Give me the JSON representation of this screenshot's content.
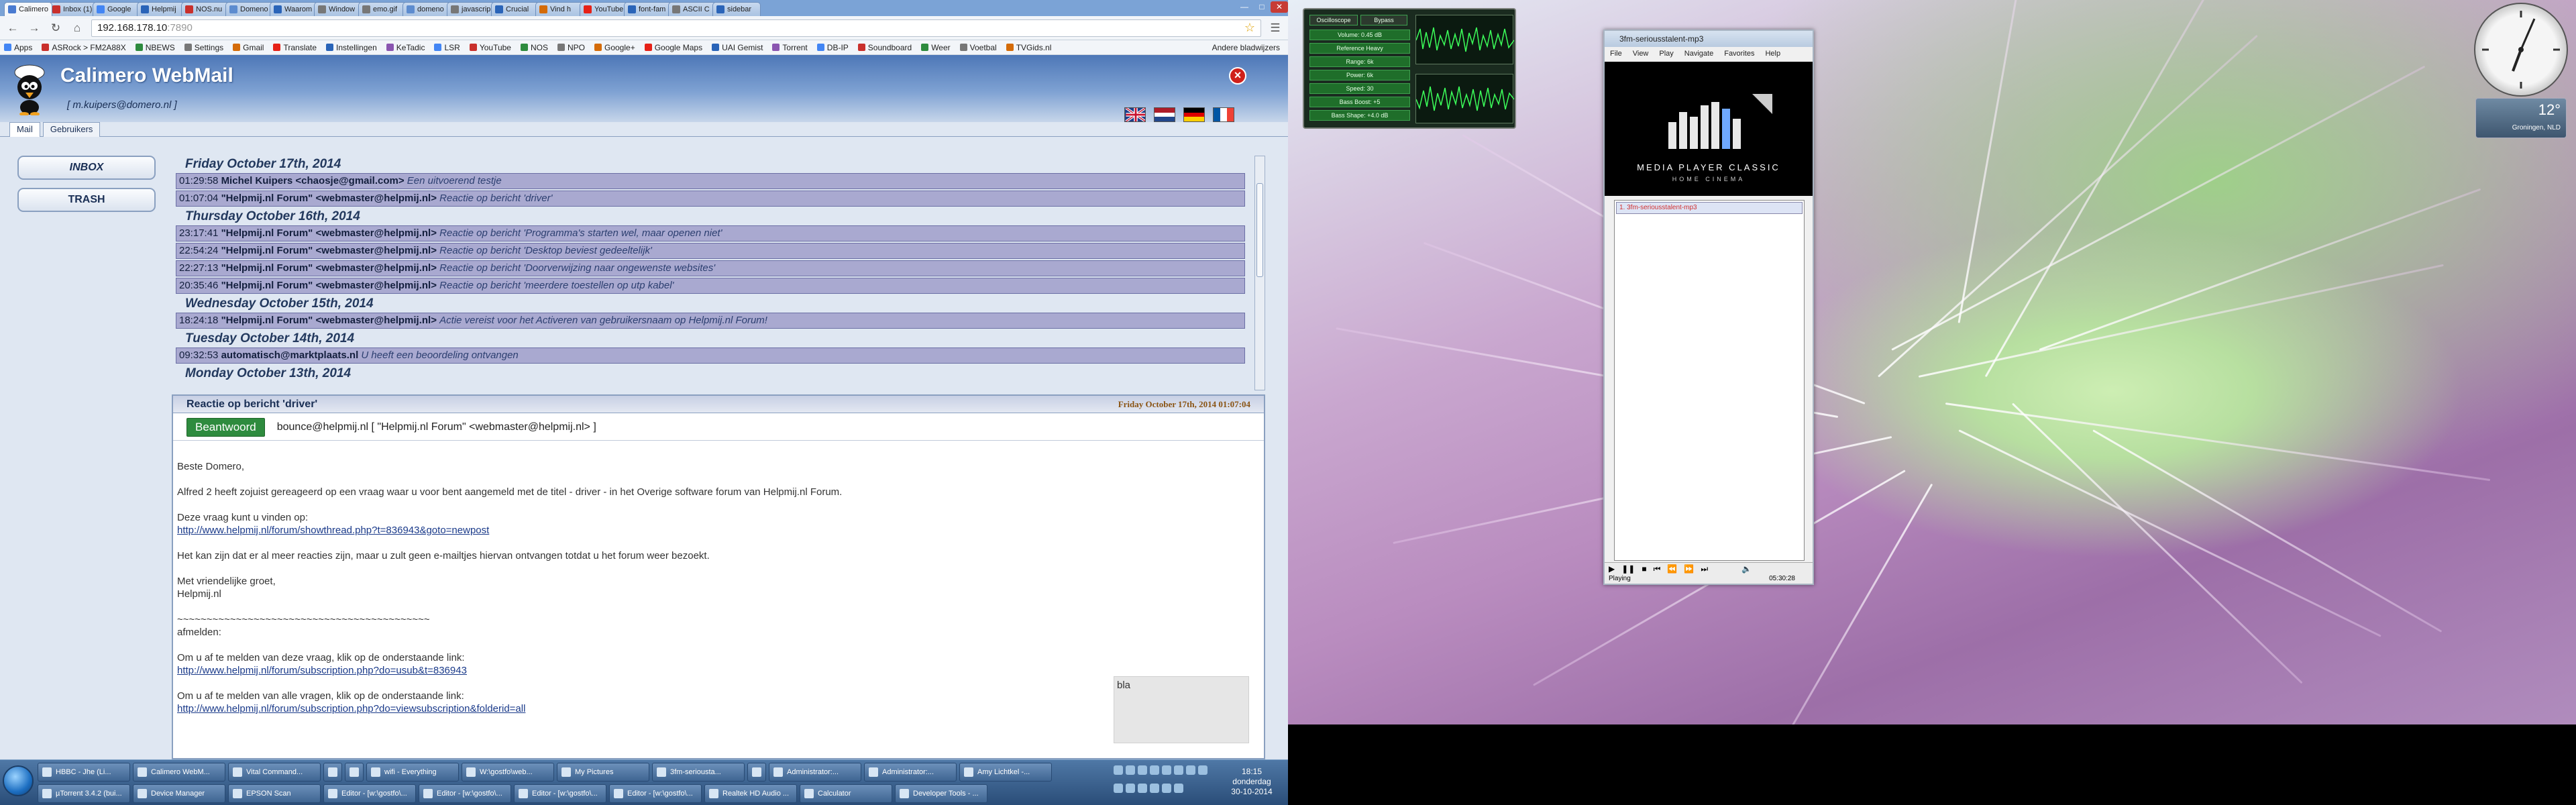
{
  "browser": {
    "tabs": [
      {
        "label": "Calimero",
        "color": "#4a7bd1",
        "active": true
      },
      {
        "label": "Inbox (1)",
        "color": "#c9302c"
      },
      {
        "label": "Google",
        "color": "#4285f4"
      },
      {
        "label": "Helpmij",
        "color": "#2a64b8"
      },
      {
        "label": "NOS.nu",
        "color": "#c9302c"
      },
      {
        "label": "Domeno",
        "color": "#5d8ccf"
      },
      {
        "label": "Waarom",
        "color": "#2a64b8"
      },
      {
        "label": "Window",
        "color": "#777777"
      },
      {
        "label": "emo.gif",
        "color": "#777777"
      },
      {
        "label": "domeno",
        "color": "#5d8ccf"
      },
      {
        "label": "javascrip",
        "color": "#777777"
      },
      {
        "label": "Crucial",
        "color": "#2a64b8"
      },
      {
        "label": "Vind h",
        "color": "#d46b08"
      },
      {
        "label": "YouTube",
        "color": "#e62117"
      },
      {
        "label": "font-fam",
        "color": "#2a64b8"
      },
      {
        "label": "ASCII C",
        "color": "#777777"
      },
      {
        "label": "sidebar",
        "color": "#2a64b8"
      }
    ],
    "url": "192.168.178.10",
    "url_port": ":7890",
    "bookmarks": [
      "Apps",
      "ASRock > FM2A88X",
      "NBEWS",
      "Settings",
      "Gmail",
      "Translate",
      "Instellingen",
      "KeTadic",
      "LSR",
      "YouTube",
      "NOS",
      "NPO",
      "Google+",
      "Google Maps",
      "UAI Gemist",
      "Torrent",
      "DB-IP",
      "Soundboard",
      "Weer",
      "Voetbal",
      "TVGids.nl"
    ],
    "other_bookmarks": "Andere bladwijzers"
  },
  "app": {
    "title": "Calimero WebMail",
    "user": "[ m.kuipers@domero.nl ]",
    "tabs": [
      "Mail",
      "Gebruikers"
    ],
    "folders": [
      "INBOX",
      "TRASH"
    ],
    "days": [
      {
        "date": "Friday October 17th, 2014",
        "mails": [
          {
            "time": "01:29:58",
            "from": "Michel Kuipers <chaosje@gmail.com>",
            "subject": "Een uitvoerend testje"
          },
          {
            "time": "01:07:04",
            "from": "\"Helpmij.nl Forum\" <webmaster@helpmij.nl>",
            "subject": "Reactie op bericht 'driver'"
          }
        ]
      },
      {
        "date": "Thursday October 16th, 2014",
        "mails": [
          {
            "time": "23:17:41",
            "from": "\"Helpmij.nl Forum\" <webmaster@helpmij.nl>",
            "subject": "Reactie op bericht 'Programma's starten wel, maar openen niet'"
          },
          {
            "time": "22:54:24",
            "from": "\"Helpmij.nl Forum\" <webmaster@helpmij.nl>",
            "subject": "Reactie op bericht 'Desktop beviest gedeeltelijk'"
          },
          {
            "time": "22:27:13",
            "from": "\"Helpmij.nl Forum\" <webmaster@helpmij.nl>",
            "subject": "Reactie op bericht 'Doorverwijzing naar ongewenste websites'"
          },
          {
            "time": "20:35:46",
            "from": "\"Helpmij.nl Forum\" <webmaster@helpmij.nl>",
            "subject": "Reactie op bericht 'meerdere toestellen op utp kabel'"
          }
        ]
      },
      {
        "date": "Wednesday October 15th, 2014",
        "mails": [
          {
            "time": "18:24:18",
            "from": "\"Helpmij.nl Forum\" <webmaster@helpmij.nl>",
            "subject": "Actie vereist voor het Activeren van gebruikersnaam op Helpmij.nl Forum!"
          }
        ]
      },
      {
        "date": "Tuesday October 14th, 2014",
        "mails": [
          {
            "time": "09:32:53",
            "from": "automatisch@marktplaats.nl",
            "subject": "U heeft een beoordeling ontvangen"
          }
        ]
      },
      {
        "date": "Monday October 13th, 2014",
        "mails": []
      }
    ],
    "preview": {
      "subject": "Reactie op bericht 'driver'",
      "date": "Friday October 17th, 2014 01:07:04",
      "reply_label": "Beantwoord",
      "from": "bounce@helpmij.nl [ \"Helpmij.nl Forum\" <webmaster@helpmij.nl> ]",
      "greeting": "Beste Domero,",
      "line1": "Alfred 2 heeft zojuist gereageerd op een vraag waar u voor bent aangemeld met de titel - driver - in het Overige software forum van Helpmij.nl Forum.",
      "line2": "Deze vraag kunt u vinden op:",
      "link1": "http://www.helpmij.nl/forum/showthread.php?t=836943&goto=newpost",
      "line3": "Het kan zijn dat er al meer reacties zijn, maar u zult geen e-mailtjes hiervan ontvangen totdat u het forum weer bezoekt.",
      "closing1": "Met vriendelijke groet,",
      "closing2": "Helpmij.nl",
      "tilde": "~~~~~~~~~~~~~~~~~~~~~~~~~~~~~~~~~~~~~~~~~~~",
      "unsub": "afmelden:",
      "line4": "Om u af te melden van deze vraag, klik op de onderstaande link:",
      "link2": "http://www.helpmij.nl/forum/subscription.php?do=usub&t=836943",
      "line5": "Om u af te melden van alle vragen, klik op de onderstaande link:",
      "link3": "http://www.helpmij.nl/forum/subscription.php?do=viewsubscription&folderid=all",
      "side_box": "bla"
    }
  },
  "taskbar": {
    "row1": [
      "HBBC - Jhe (Li...",
      "Calimero WebM...",
      "Vital Command...",
      "",
      "",
      "wifi - Everything",
      "W:\\gostfo\\web...",
      "My Pictures",
      "3fm-seriousta...",
      "",
      "Administrator:...",
      "Administrator:...",
      "Amy Lichtkel -..."
    ],
    "row2": [
      "µTorrent 3.4.2 (bui...",
      "Device Manager",
      "EPSON Scan",
      "Editor - [w:\\gostfo\\...",
      "Editor - [w:\\gostfo\\...",
      "Editor - [w:\\gostfo\\...",
      "Editor - [w:\\gostfo\\...",
      "Realtek HD Audio ...",
      "Calculator",
      "Developer Tools - ..."
    ],
    "time": "18:15",
    "day": "donderdag",
    "date": "30-10-2014"
  },
  "desktop": {
    "eq_rows": [
      "Volume: 0.45 dB",
      "Reference Heavy",
      "Range: 6k",
      "Power: 6k",
      "Speed: 30",
      "Bass Boost: +5",
      "Bass Shape: +4.0 dB"
    ],
    "eq_head": [
      "Oscilloscope",
      "Bypass"
    ],
    "weather_temp": "12°",
    "weather_city": "Groningen, NLD",
    "mpc": {
      "title": "3fm-seriousstalent-mp3",
      "menu": [
        "File",
        "View",
        "Play",
        "Navigate",
        "Favorites",
        "Help"
      ],
      "brand": "MEDIA PLAYER CLASSIC",
      "brand_sub": "HOME CINEMA",
      "playlist_item": "1. 3fm-seriousstalent-mp3",
      "status": "Playing",
      "time": "05:30:28"
    }
  }
}
